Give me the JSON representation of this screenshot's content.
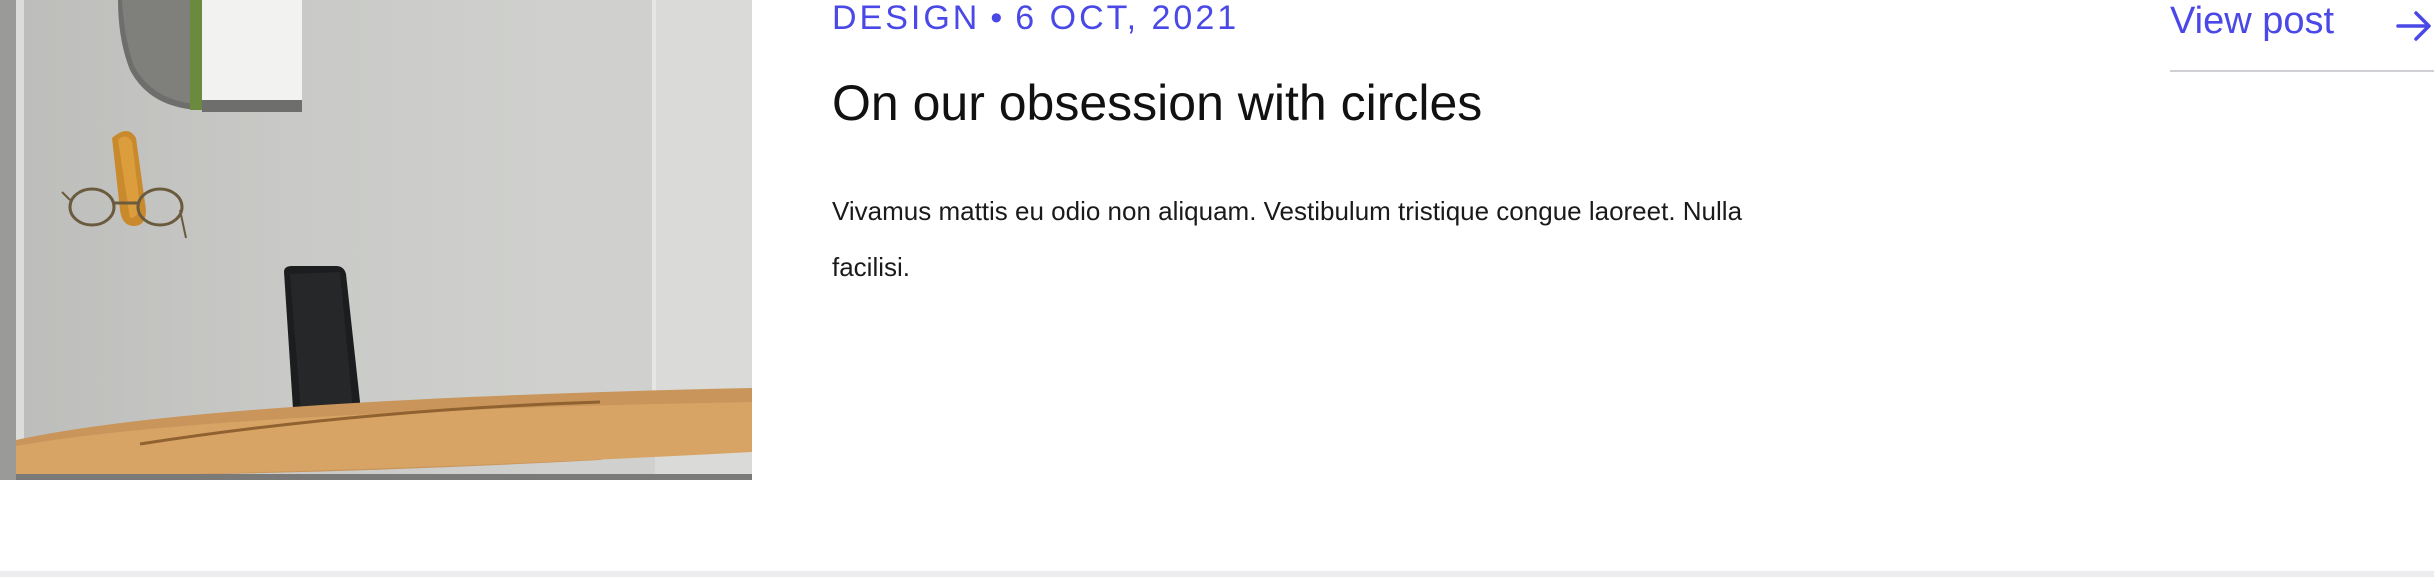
{
  "post": {
    "category": "DESIGN",
    "separator": "•",
    "date": "6 OCT, 2021",
    "title": "On our obsession with circles",
    "excerpt": "Vivamus mattis eu odio non aliquam. Vestibulum tristique congue laoreet. Nulla facilisi.",
    "view_label": "View post",
    "view_icon": "arrow-right-icon"
  },
  "colors": {
    "accent": "#4a48e6",
    "title_text": "#111111",
    "body_text": "#1a1a1a",
    "divider": "#cfd0d4",
    "background": "#ffffff"
  }
}
